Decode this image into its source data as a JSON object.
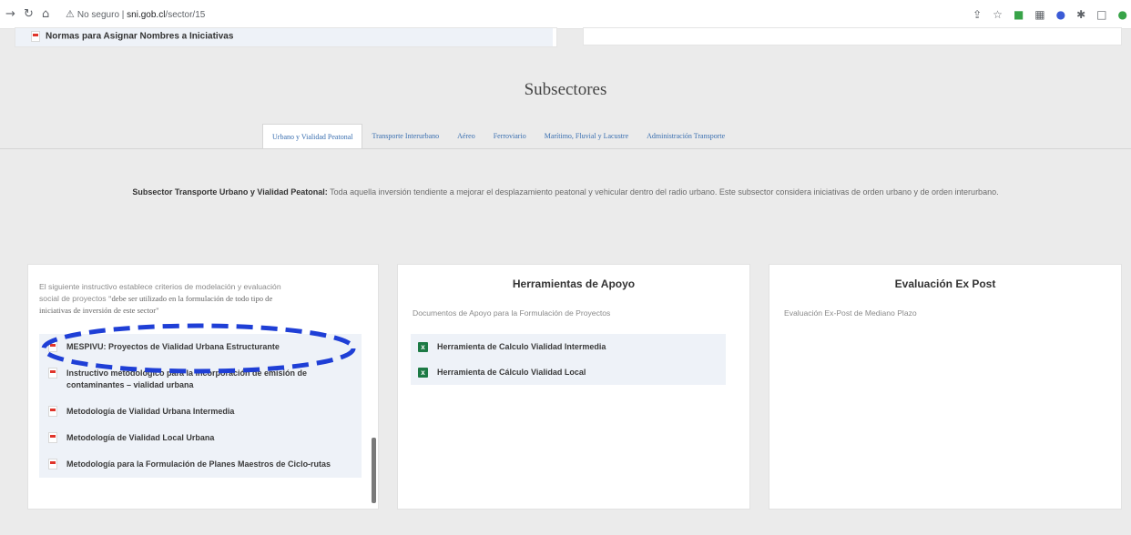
{
  "browser": {
    "security_label": "No seguro",
    "url_host": "sni.gob.cl",
    "url_path": "/sector/15"
  },
  "top_doc": "Normas para Asignar Nombres a Iniciativas",
  "subsectors": {
    "title": "Subsectores",
    "tabs": [
      {
        "label": "Urbano y Vialidad Peatonal",
        "active": true
      },
      {
        "label": "Transporte Interurbano"
      },
      {
        "label": "Aéreo"
      },
      {
        "label": "Ferroviario"
      },
      {
        "label": "Marítimo, Fluvial y Lacustre"
      },
      {
        "label": "Administración Transporte"
      }
    ],
    "description_label": "Subsector Transporte Urbano y Vialidad Peatonal:",
    "description_text": "Toda aquella inversión tendiente a mejorar el desplazamiento peatonal y vehicular dentro del radio urbano. Este subsector considera iniciativas de orden urbano y de orden interurbano."
  },
  "card_methodologies": {
    "intro_line1": "El siguiente instructivo establece criterios de modelación y evaluación",
    "intro_line2_a": "social de proyectos ",
    "intro_line2_b": "\"debe ser utilizado en la formulación de todo tipo de",
    "intro_line3": "iniciativas de inversión de este sector\"",
    "docs": [
      "MESPIVU: Proyectos de Vialidad Urbana Estructurante",
      "Instructivo metodológico para la incorporación de emisión de contaminantes – vialidad urbana",
      "Metodología de Vialidad Urbana Intermedia",
      "Metodología de Vialidad Local Urbana",
      "Metodología para la Formulación de Planes Maestros de Ciclo-rutas"
    ]
  },
  "card_tools": {
    "title": "Herramientas de Apoyo",
    "subtitle": "Documentos de Apoyo para la Formulación de Proyectos",
    "items": [
      "Herramienta de Calculo Vialidad Intermedia",
      "Herramienta de Cálculo Vialidad Local"
    ]
  },
  "card_expost": {
    "title": "Evaluación Ex Post",
    "subtitle": "Evaluación Ex-Post de Mediano Plazo"
  },
  "colors": {
    "accent_link": "#3a6fb0",
    "annotation": "#1f3fd6",
    "pdf_red": "#e0352b",
    "excel_green": "#1d7a45"
  }
}
